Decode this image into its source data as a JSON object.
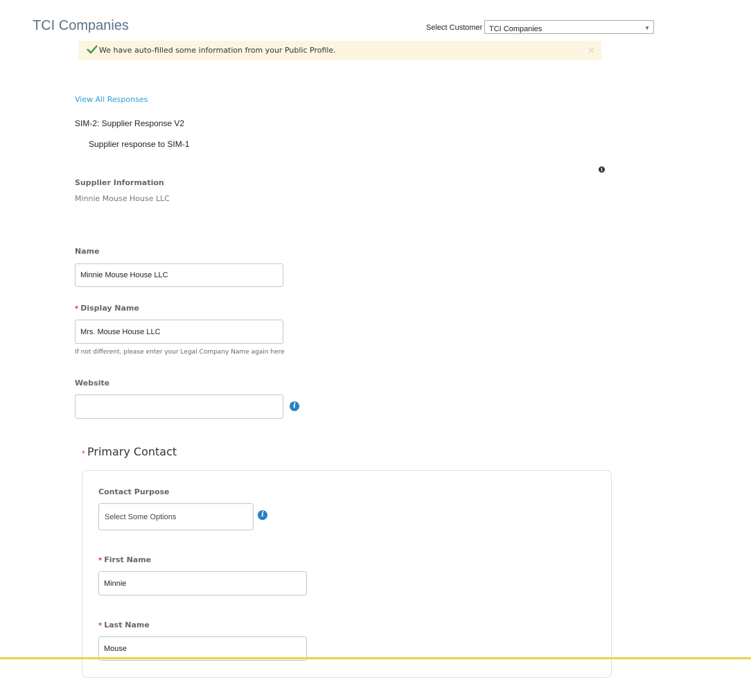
{
  "header": {
    "company_title": "TCI Companies",
    "select_customer_label": "Select Customer",
    "select_customer_value": "TCI Companies"
  },
  "banner": {
    "message": "We have auto-filled some information from your Public Profile.",
    "close_symbol": "✕"
  },
  "responses": {
    "view_all_link": "View All Responses",
    "title": "SIM-2: Supplier Response V2",
    "subtitle": "Supplier response to SIM-1"
  },
  "supplier_info": {
    "label": "Supplier Information",
    "value": "Minnie Mouse House LLC"
  },
  "form": {
    "name_label": "Name",
    "name_value": "Minnie Mouse House LLC",
    "display_name_label": "Display Name",
    "display_name_value": "Mrs. Mouse House LLC",
    "display_name_hint": "If not different, please enter your Legal Company Name again here",
    "website_label": "Website",
    "website_value": ""
  },
  "primary_contact": {
    "title": "Primary Contact",
    "contact_purpose_label": "Contact Purpose",
    "contact_purpose_placeholder": "Select Some Options",
    "first_name_label": "First Name",
    "first_name_value": "Minnie",
    "last_name_label": "Last Name",
    "last_name_value": "Mouse"
  },
  "icons": {
    "info_dark": "i",
    "info_blue": "i",
    "required_mark": "*",
    "caret": "▼"
  },
  "colors": {
    "accent_link": "#2a9fd6",
    "banner_bg": "#fcf6e1",
    "check_green": "#3c9a3c",
    "info_blue": "#2a80c3",
    "required_red": "#d32f2f"
  }
}
